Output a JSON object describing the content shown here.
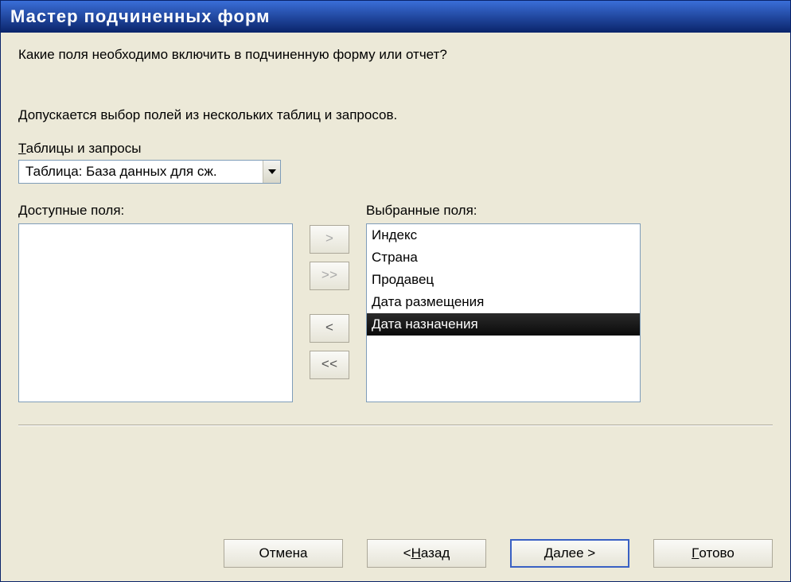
{
  "titlebar": "Мастер подчиненных форм",
  "question": "Какие поля необходимо включить в подчиненную форму или отчет?",
  "hint": "Допускается выбор полей из нескольких таблиц и запросов.",
  "labels": {
    "tables_queries_u": "Т",
    "tables_queries_rest": "аблицы и запросы",
    "available": "Доступные поля:",
    "selected": "Выбранные поля:"
  },
  "combo": {
    "value": "Таблица: База данных для сж."
  },
  "available_fields": [],
  "selected_fields": [
    {
      "label": "Индекс",
      "selected": false
    },
    {
      "label": "Страна",
      "selected": false
    },
    {
      "label": "Продавец",
      "selected": false
    },
    {
      "label": "Дата размещения",
      "selected": false
    },
    {
      "label": "Дата назначения",
      "selected": true
    }
  ],
  "mover": {
    "add": ">",
    "add_all": ">>",
    "remove": "<",
    "remove_all": "<<"
  },
  "footer": {
    "cancel": "Отмена",
    "back_pre": "< ",
    "back_u": "Н",
    "back_rest": "азад",
    "next_u": "Д",
    "next_rest": "алее >",
    "finish_u": "Г",
    "finish_rest": "отово"
  }
}
